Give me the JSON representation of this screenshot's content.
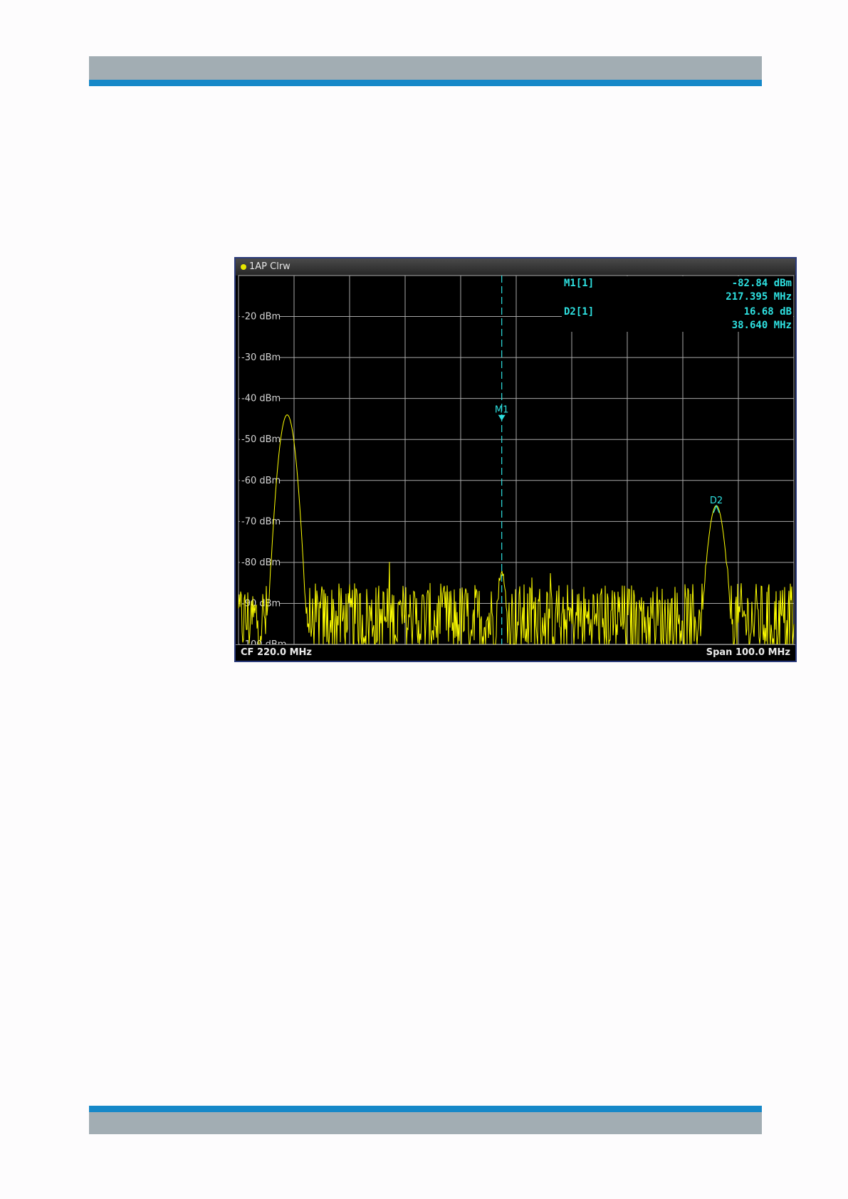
{
  "chart_data": {
    "type": "line",
    "title": "1AP Clrw",
    "trace_label": "1AP Clrw",
    "center_frequency": "CF 220.0 MHz",
    "span": "Span 100.0 MHz",
    "x_unit": "MHz",
    "xlim": [
      170,
      270
    ],
    "ylim": [
      -100,
      -10
    ],
    "y_tick_values": [
      -20,
      -30,
      -40,
      -50,
      -60,
      -70,
      -80,
      -90,
      -100
    ],
    "y_tick_labels": [
      "-20 dBm",
      "-30 dBm",
      "-40 dBm",
      "-50 dBm",
      "-60 dBm",
      "-70 dBm",
      "-80 dBm",
      "-90 dBm",
      "-100 dBm"
    ],
    "grid": true,
    "noise_floor_dbm": -94,
    "peaks": [
      {
        "freq": 178.76,
        "level": -44.0
      },
      {
        "freq": 217.395,
        "level": -82.84
      },
      {
        "freq": 256.035,
        "level": -66.16
      }
    ],
    "markers": [
      {
        "name": "M1",
        "freq": 217.395,
        "level": -82.84,
        "readout_label": "M1[1]",
        "readout_value": "-82.84 dBm",
        "readout_freq": "217.395 MHz"
      },
      {
        "name": "D2",
        "freq": 256.035,
        "level": -66.16,
        "readout_label": "D2[1]",
        "readout_value": "16.68 dB",
        "readout_freq": "38.640 MHz"
      }
    ],
    "colors": {
      "trace": "#ffff00",
      "marker": "#2ee0e0",
      "grid": "#a8a8a8",
      "background": "#000000",
      "frame_border": "#2a3a7a"
    }
  }
}
